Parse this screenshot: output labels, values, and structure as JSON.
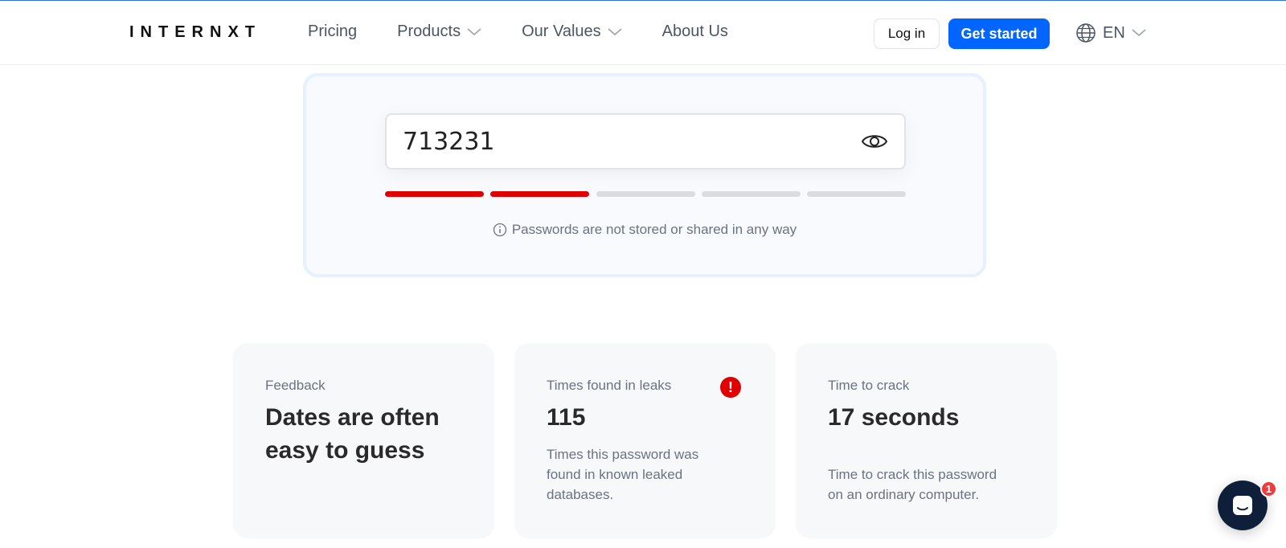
{
  "header": {
    "logo": "INTERNXT",
    "nav": [
      {
        "label": "Pricing",
        "dropdown": false
      },
      {
        "label": "Products",
        "dropdown": true
      },
      {
        "label": "Our Values",
        "dropdown": true
      },
      {
        "label": "About Us",
        "dropdown": false
      }
    ],
    "login_label": "Log in",
    "get_started_label": "Get started",
    "language": "EN"
  },
  "password_checker": {
    "value": "713231",
    "strength_filled": 2,
    "strength_total": 5,
    "strength_color": "#e00000",
    "note": "Passwords are not stored or shared in any way"
  },
  "stats": {
    "feedback": {
      "label": "Feedback",
      "value": "Dates are often easy to guess"
    },
    "leaks": {
      "label": "Times found in leaks",
      "value": "115",
      "description": "Times this password was found in known leaked databases.",
      "alert_icon": "!"
    },
    "crack": {
      "label": "Time to crack",
      "value": "17 seconds",
      "description": "Time to crack this password on an ordinary computer."
    }
  },
  "chat": {
    "badge_count": "1"
  },
  "colors": {
    "accent": "#0066ff",
    "danger": "#e00000"
  }
}
